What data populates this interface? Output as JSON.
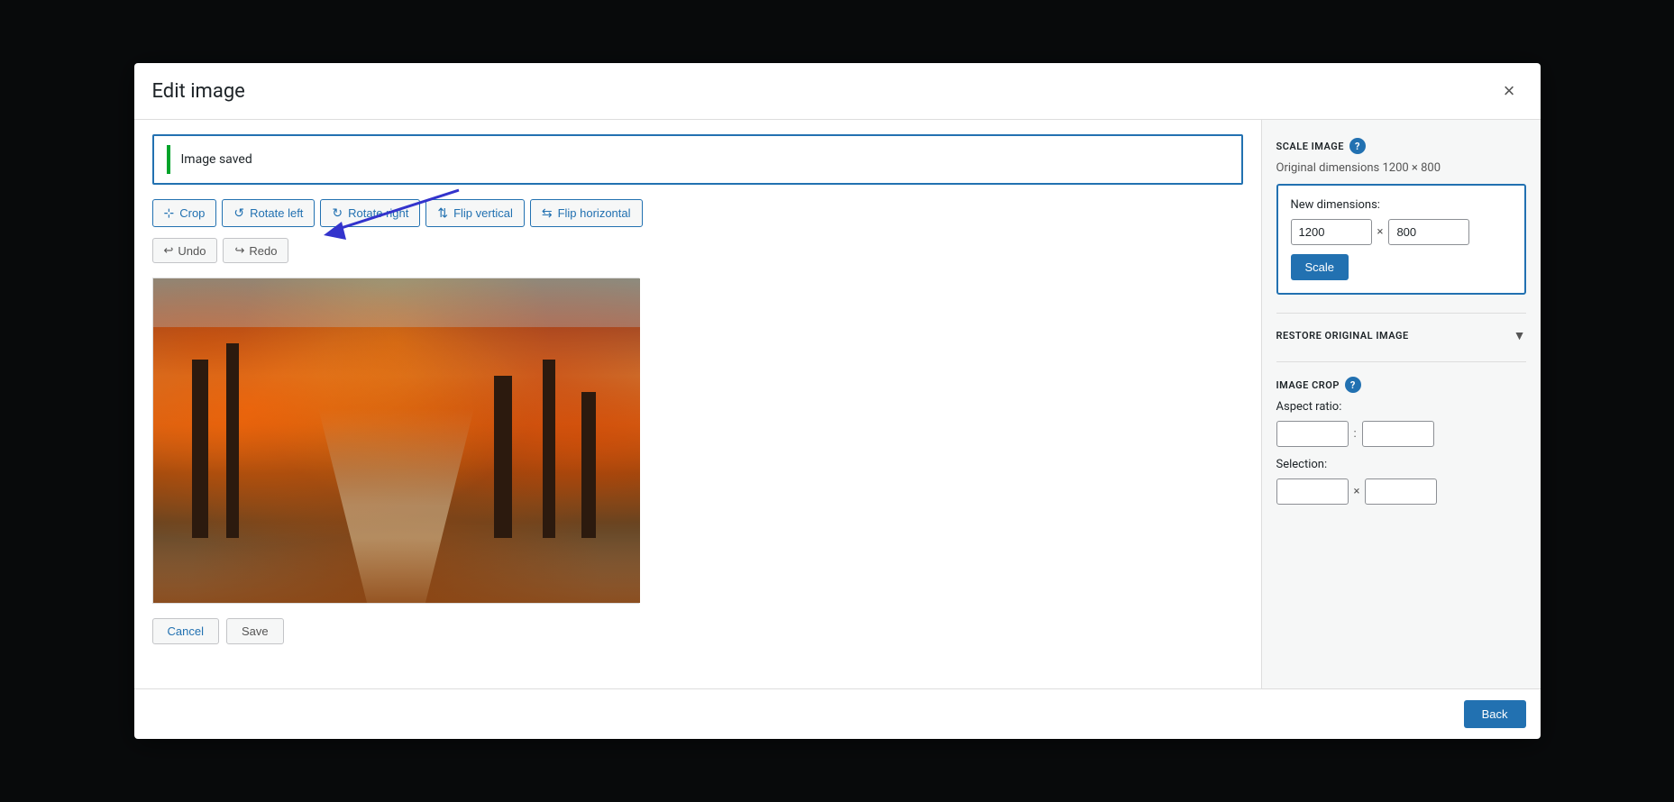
{
  "modal": {
    "title": "Edit image",
    "close_label": "×"
  },
  "notice": {
    "text": "Image saved"
  },
  "toolbar": {
    "crop_label": "Crop",
    "rotate_left_label": "Rotate left",
    "rotate_right_label": "Rotate right",
    "flip_vertical_label": "Flip vertical",
    "flip_horizontal_label": "Flip horizontal"
  },
  "undo_redo": {
    "undo_label": "Undo",
    "redo_label": "Redo"
  },
  "footer": {
    "cancel_label": "Cancel",
    "save_label": "Save"
  },
  "sidebar": {
    "scale_image_title": "SCALE IMAGE",
    "help_label": "?",
    "original_dims": "Original dimensions 1200 × 800",
    "new_dims_label": "New dimensions:",
    "width_value": "1200",
    "height_value": "800",
    "scale_btn": "Scale",
    "restore_title": "RESTORE ORIGINAL IMAGE",
    "image_crop_title": "IMAGE CROP",
    "aspect_ratio_label": "Aspect ratio:",
    "selection_label": "Selection:",
    "back_btn": "Back"
  }
}
